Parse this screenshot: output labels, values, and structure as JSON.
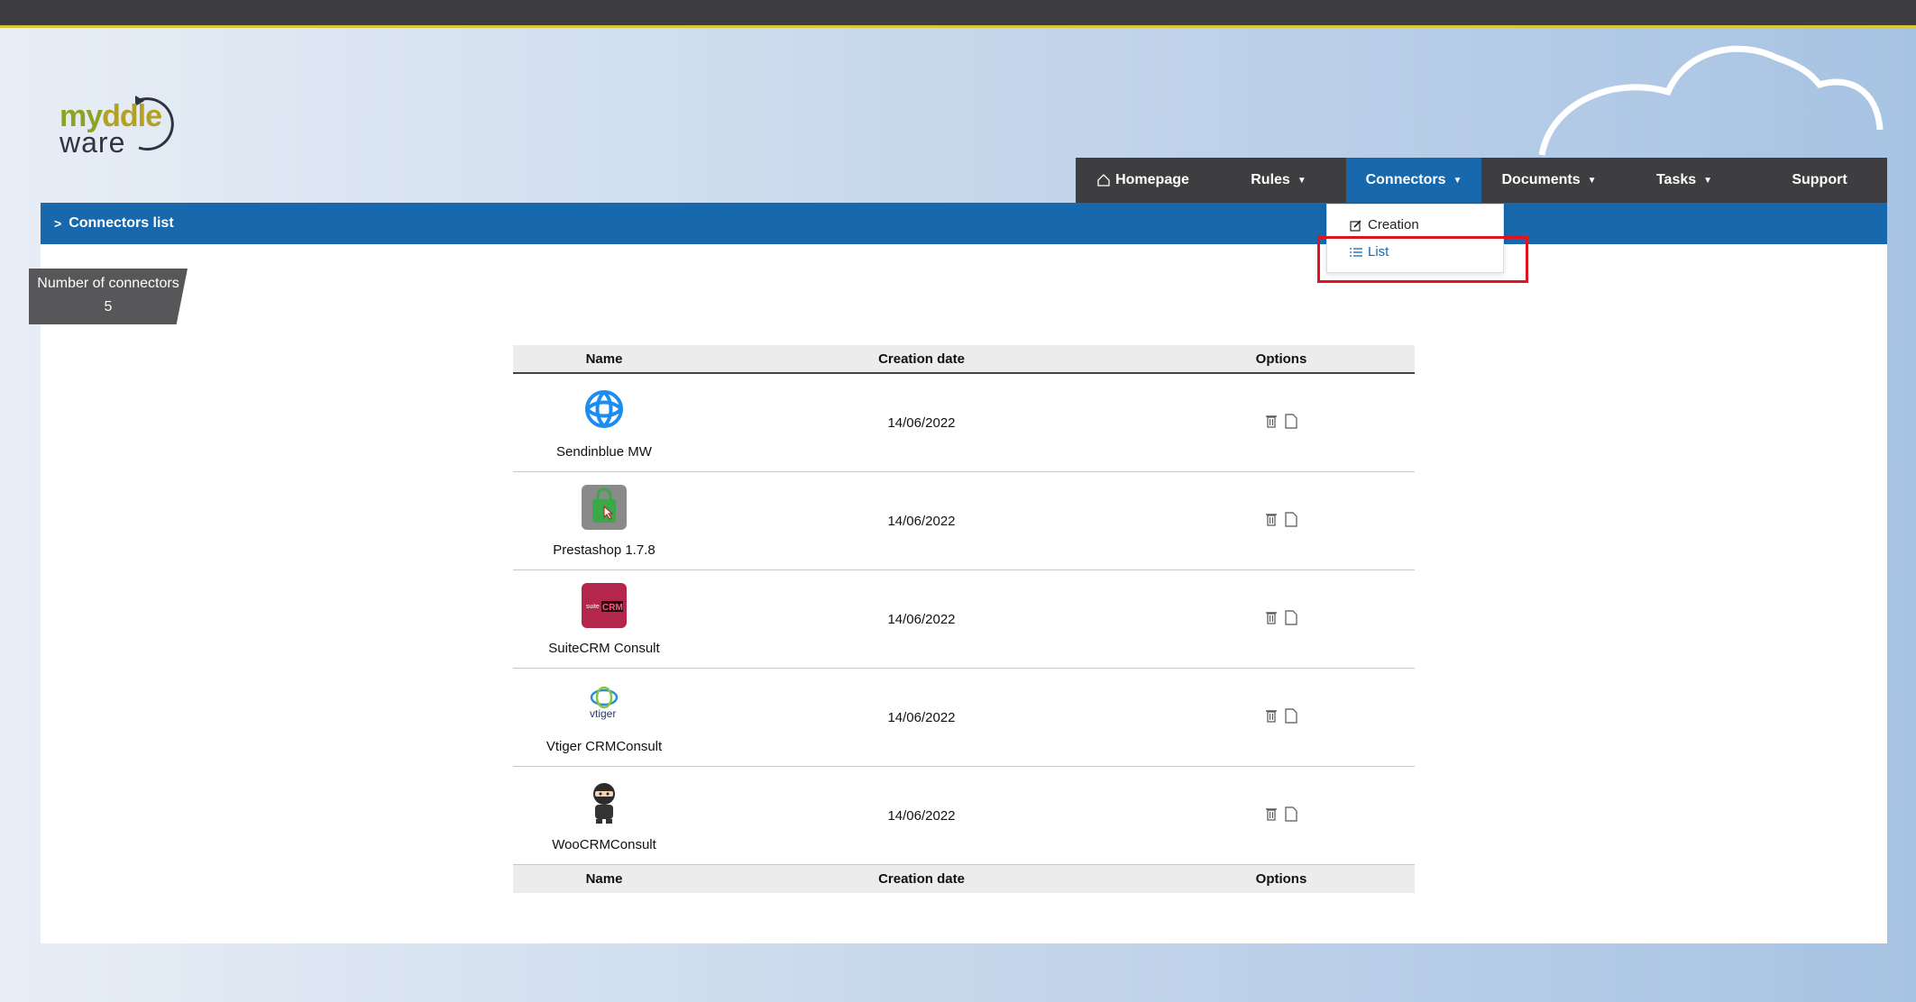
{
  "brand": {
    "logo_line1_a": "my",
    "logo_line1_b": "ddle",
    "logo_line2": "ware"
  },
  "nav": {
    "items": [
      {
        "label": "Homepage"
      },
      {
        "label": "Rules"
      },
      {
        "label": "Connectors"
      },
      {
        "label": "Documents"
      },
      {
        "label": "Tasks"
      },
      {
        "label": "Support"
      }
    ],
    "active": "Connectors"
  },
  "dropdown": {
    "creation": "Creation",
    "list": "List"
  },
  "page": {
    "title": "Connectors list"
  },
  "counter": {
    "label": "Number of connectors",
    "value": "5"
  },
  "table": {
    "headers": [
      "Name",
      "Creation date",
      "Options"
    ],
    "rows": [
      {
        "name": "Sendinblue MW",
        "date": "14/06/2022",
        "icon": "sendinblue-logo"
      },
      {
        "name": "Prestashop 1.7.8",
        "date": "14/06/2022",
        "icon": "prestashop-logo"
      },
      {
        "name": "SuiteCRM Consult",
        "date": "14/06/2022",
        "icon": "suitecrm-logo"
      },
      {
        "name": "Vtiger CRMConsult",
        "date": "14/06/2022",
        "icon": "vtiger-logo"
      },
      {
        "name": "WooCRMConsult",
        "date": "14/06/2022",
        "icon": "woocommerce-logo"
      }
    ]
  },
  "logo_texts": {
    "suitecrm_small": "suite",
    "suitecrm_big": "CRM",
    "vtiger": "vtiger"
  },
  "colors": {
    "nav_bg": "#3e3e40",
    "accent": "#1768ad",
    "highlight": "#e0141e",
    "logo_green": "#8ea224"
  }
}
